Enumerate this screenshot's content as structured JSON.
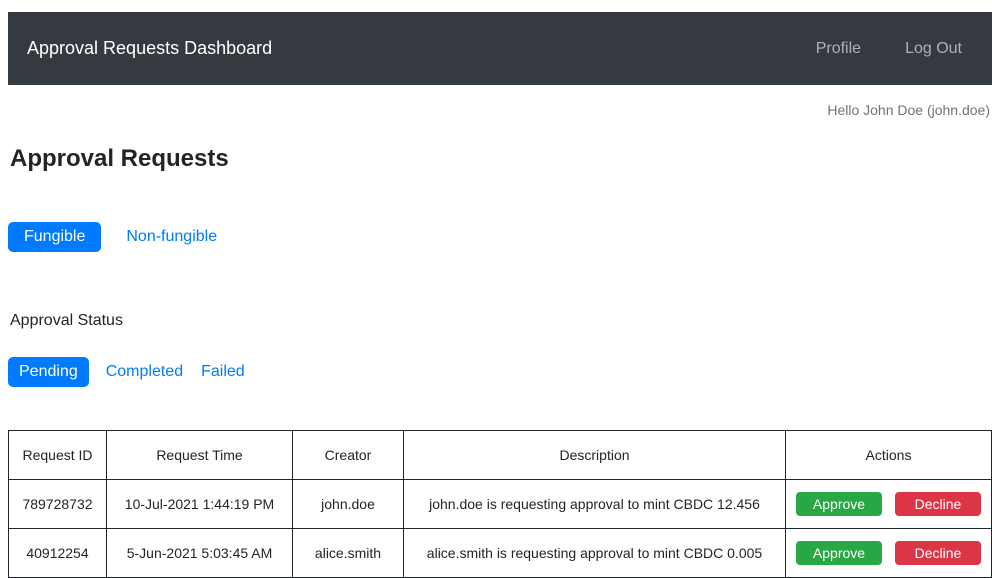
{
  "navbar": {
    "brand": "Approval Requests Dashboard",
    "links": [
      "Profile",
      "Log Out"
    ]
  },
  "greeting": "Hello John Doe (john.doe)",
  "page_title": "Approval Requests",
  "asset_tabs": {
    "items": [
      "Fungible",
      "Non-fungible"
    ],
    "active": "Fungible"
  },
  "status_section": {
    "label": "Approval Status",
    "items": [
      "Pending",
      "Completed",
      "Failed"
    ],
    "active": "Pending"
  },
  "table": {
    "headers": [
      "Request ID",
      "Request Time",
      "Creator",
      "Description",
      "Actions"
    ],
    "rows": [
      {
        "id": "789728732",
        "time": "10-Jul-2021 1:44:19 PM",
        "creator": "john.doe",
        "description": "john.doe is requesting approval to mint CBDC 12.456",
        "approve": "Approve",
        "decline": "Decline"
      },
      {
        "id": "40912254",
        "time": "5-Jun-2021 5:03:45 AM",
        "creator": "alice.smith",
        "description": "alice.smith is requesting approval to mint CBDC 0.005",
        "approve": "Approve",
        "decline": "Decline"
      }
    ]
  },
  "colors": {
    "navbar_bg": "#343a40",
    "primary": "#007bff",
    "approve": "#28a745",
    "decline": "#dc3545"
  }
}
